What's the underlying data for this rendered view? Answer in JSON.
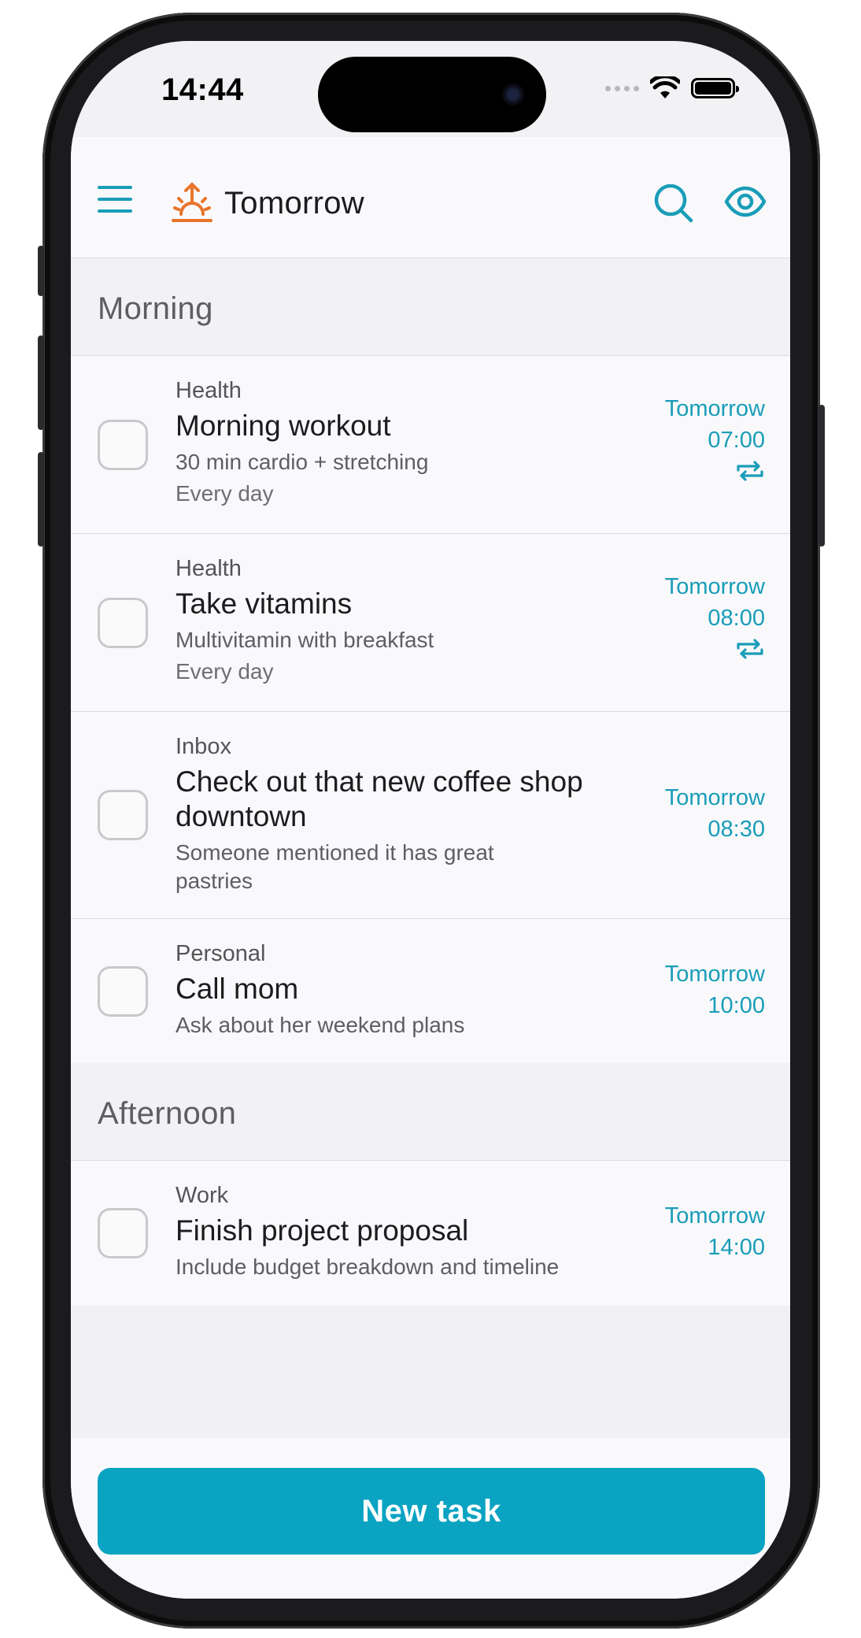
{
  "status_bar": {
    "time": "14:44"
  },
  "header": {
    "title": "Tomorrow"
  },
  "sections": [
    {
      "title": "Morning",
      "tasks": [
        {
          "category": "Health",
          "title": "Morning workout",
          "description": "30 min cardio + stretching",
          "repeat_text": "Every day",
          "date": "Tomorrow",
          "time": "07:00"
        },
        {
          "category": "Health",
          "title": "Take vitamins",
          "description": "Multivitamin with breakfast",
          "repeat_text": "Every day",
          "date": "Tomorrow",
          "time": "08:00"
        },
        {
          "category": "Inbox",
          "title": "Check out that new coffee shop downtown",
          "description": "Someone mentioned it has great pastries",
          "date": "Tomorrow",
          "time": "08:30"
        },
        {
          "category": "Personal",
          "title": "Call mom",
          "description": "Ask about her weekend plans",
          "date": "Tomorrow",
          "time": "10:00"
        }
      ]
    },
    {
      "title": "Afternoon",
      "tasks": [
        {
          "category": "Work",
          "title": "Finish project proposal",
          "description": "Include budget breakdown and timeline",
          "date": "Tomorrow",
          "time": "14:00"
        }
      ]
    }
  ],
  "footer": {
    "new_task_label": "New task"
  },
  "icons": {
    "menu": "hamburger-menu-icon",
    "title": "sunrise-icon",
    "search": "search-icon",
    "visibility": "eye-icon",
    "repeat": "repeat-icon"
  },
  "colors": {
    "accent": "#0aa3c2",
    "title_icon": "#e8742a"
  }
}
